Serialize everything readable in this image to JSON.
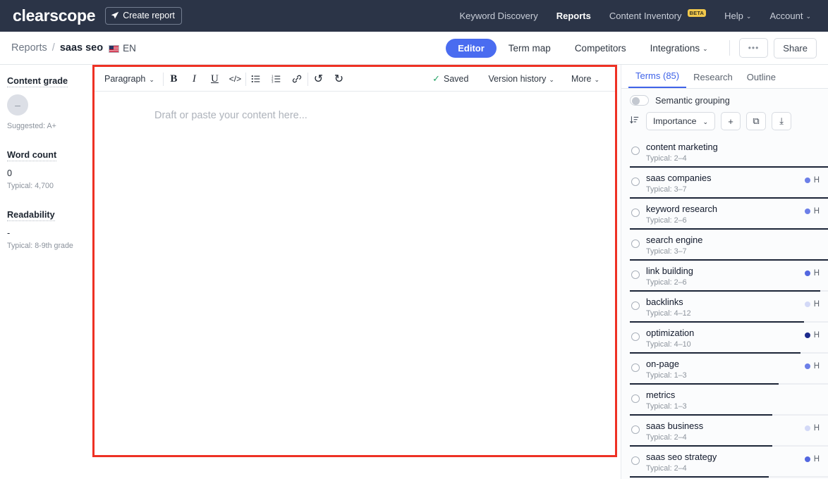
{
  "topnav": {
    "brand": "clearscope",
    "create_report": "Create report",
    "send_icon": "send-icon",
    "links": [
      {
        "label": "Keyword Discovery",
        "active": false,
        "caret": "",
        "badge": ""
      },
      {
        "label": "Reports",
        "active": true,
        "caret": "",
        "badge": ""
      },
      {
        "label": "Content Inventory",
        "active": false,
        "caret": "",
        "badge": "BETA"
      },
      {
        "label": "Help",
        "active": false,
        "caret": "⌄",
        "badge": ""
      },
      {
        "label": "Account",
        "active": false,
        "caret": "⌄",
        "badge": ""
      }
    ]
  },
  "subheader": {
    "crumb_root": "Reports",
    "crumb_sep": "/",
    "crumb_current": "saas seo",
    "language": "EN",
    "flag": "us-flag-icon",
    "editor_pill": "Editor",
    "links": [
      {
        "label": "Term map",
        "caret": ""
      },
      {
        "label": "Competitors",
        "caret": ""
      },
      {
        "label": "Integrations",
        "caret": "⌄"
      }
    ],
    "more_dots": "•••",
    "share": "Share"
  },
  "stats": [
    {
      "title": "Content grade",
      "badge": "–",
      "value": "",
      "sub": "Suggested: A+"
    },
    {
      "title": "Word count",
      "badge": "",
      "value": "0",
      "sub": "Typical: 4,700"
    },
    {
      "title": "Readability",
      "badge": "",
      "value": "-",
      "sub": "Typical: 8-9th grade"
    }
  ],
  "editor": {
    "paragraph_label": "Paragraph",
    "caret": "⌄",
    "format_buttons": [
      {
        "name": "bold-button",
        "glyph": "B",
        "cls": "bold"
      },
      {
        "name": "italic-button",
        "glyph": "I",
        "cls": "ital"
      },
      {
        "name": "underline-button",
        "glyph": "U",
        "cls": "undl"
      },
      {
        "name": "code-button",
        "glyph": "</>",
        "cls": "code"
      }
    ],
    "list_buttons": [
      {
        "name": "bullet-list-button",
        "glyph": "☰",
        "cls": ""
      },
      {
        "name": "numbered-list-button",
        "glyph": "☰",
        "cls": ""
      },
      {
        "name": "link-button",
        "glyph": "🔗",
        "cls": ""
      }
    ],
    "history_buttons": [
      {
        "name": "undo-button",
        "glyph": "↺",
        "cls": ""
      },
      {
        "name": "redo-button",
        "glyph": "↻",
        "cls": ""
      }
    ],
    "saved_label": "Saved",
    "saved_check": "✓",
    "version_history": "Version history",
    "more": "More",
    "placeholder": "Draft or paste your content here..."
  },
  "terms_panel": {
    "tabs": [
      {
        "label": "Terms (85)",
        "active": true
      },
      {
        "label": "Research",
        "active": false
      },
      {
        "label": "Outline",
        "active": false
      }
    ],
    "semantic_grouping_label": "Semantic grouping",
    "semantic_grouping_on": false,
    "sort_icon": "sort-descending-icon",
    "sort_value": "Importance",
    "sort_caret": "⌄",
    "add_button": "+",
    "copy_button": "⧉",
    "download_button": "⤓",
    "terms": [
      {
        "name": "content marketing",
        "typical": "Typical: 2–4",
        "heading": "",
        "dot": "",
        "bar": 100
      },
      {
        "name": "saas companies",
        "typical": "Typical: 3–7",
        "heading": "H",
        "dot": "#6c7fe8",
        "bar": 100
      },
      {
        "name": "keyword research",
        "typical": "Typical: 2–6",
        "heading": "H",
        "dot": "#6c7fe8",
        "bar": 100
      },
      {
        "name": "search engine",
        "typical": "Typical: 3–7",
        "heading": "",
        "dot": "",
        "bar": 100
      },
      {
        "name": "link building",
        "typical": "Typical: 2–6",
        "heading": "H",
        "dot": "#5367e0",
        "bar": 96
      },
      {
        "name": "backlinks",
        "typical": "Typical: 4–12",
        "heading": "H",
        "dot": "#d3d9f7",
        "bar": 88
      },
      {
        "name": "optimization",
        "typical": "Typical: 4–10",
        "heading": "H",
        "dot": "#1c2a8c",
        "bar": 86
      },
      {
        "name": "on-page",
        "typical": "Typical: 1–3",
        "heading": "H",
        "dot": "#6c7fe8",
        "bar": 75
      },
      {
        "name": "metrics",
        "typical": "Typical: 1–3",
        "heading": "",
        "dot": "",
        "bar": 72
      },
      {
        "name": "saas business",
        "typical": "Typical: 2–4",
        "heading": "H",
        "dot": "#d3d9f7",
        "bar": 72
      },
      {
        "name": "saas seo strategy",
        "typical": "Typical: 2–4",
        "heading": "H",
        "dot": "#5367e0",
        "bar": 70
      }
    ]
  },
  "colors": {
    "nav_bg": "#2b3447",
    "accent": "#4a6cf0",
    "highlight_border": "#ee3124",
    "beta_badge": "#f2c94c"
  }
}
